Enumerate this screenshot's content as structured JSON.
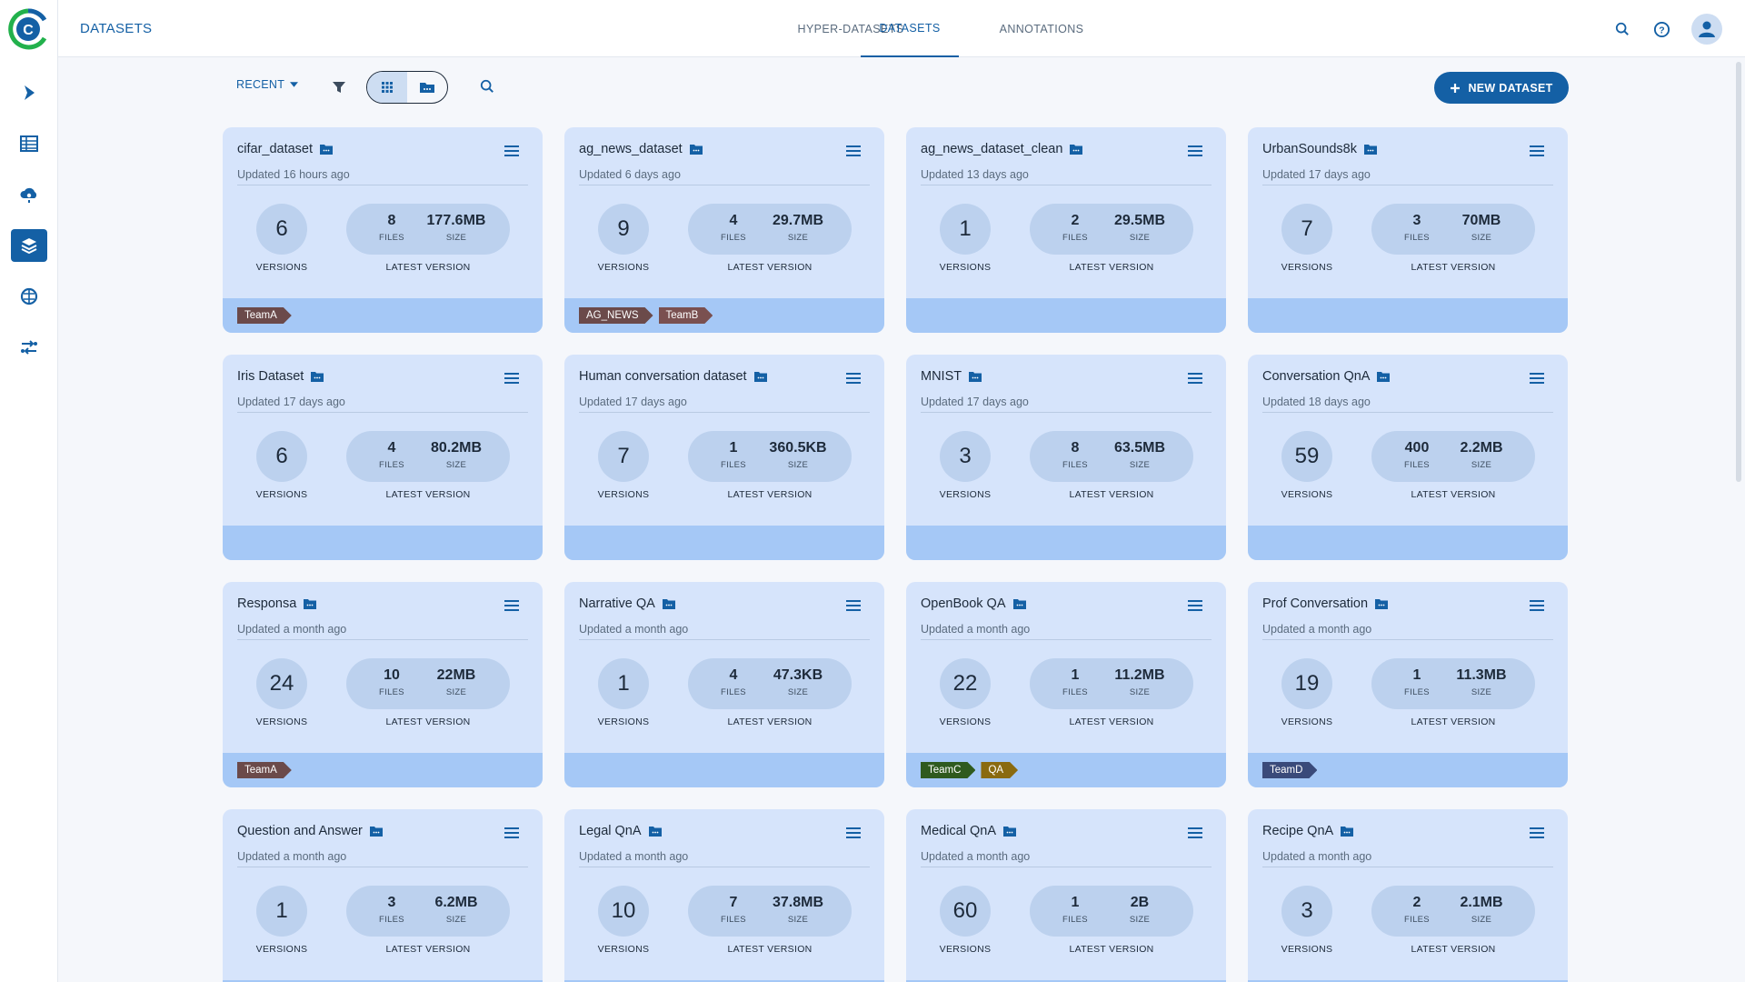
{
  "header": {
    "title": "DATASETS",
    "tabs": [
      {
        "label": "HYPER-DATASETS"
      },
      {
        "label": "DATASETS"
      },
      {
        "label": "ANNOTATIONS"
      }
    ]
  },
  "sidebar": {
    "items": [
      {
        "icon": "pipeline-play-icon"
      },
      {
        "icon": "table-icon"
      },
      {
        "icon": "cloud-gear-icon"
      },
      {
        "icon": "layers-icon"
      },
      {
        "icon": "brain-icon"
      },
      {
        "icon": "workflow-icon"
      }
    ]
  },
  "toolbar": {
    "sort_label": "RECENT",
    "new_dataset_label": "NEW DATASET"
  },
  "colors": {
    "accent": "#1460a5",
    "card": "#d6e4fb",
    "card_footer": "#a5c8f6"
  },
  "labels": {
    "versions": "VERSIONS",
    "latest_version": "LATEST VERSION",
    "files": "FILES",
    "size": "SIZE"
  },
  "cards": [
    {
      "name": "cifar_dataset",
      "updated": "Updated 16 hours ago",
      "versions": "6",
      "files": "8",
      "size": "177.6MB",
      "tags": [
        {
          "label": "TeamA",
          "color": "#6b4a4a"
        }
      ]
    },
    {
      "name": "ag_news_dataset",
      "updated": "Updated 6 days ago",
      "versions": "9",
      "files": "4",
      "size": "29.7MB",
      "tags": [
        {
          "label": "AG_NEWS",
          "color": "#6b4a4a"
        },
        {
          "label": "TeamB",
          "color": "#7a5050"
        }
      ]
    },
    {
      "name": "ag_news_dataset_clean",
      "updated": "Updated 13 days ago",
      "versions": "1",
      "files": "2",
      "size": "29.5MB",
      "tags": []
    },
    {
      "name": "UrbanSounds8k",
      "updated": "Updated 17 days ago",
      "versions": "7",
      "files": "3",
      "size": "70MB",
      "tags": []
    },
    {
      "name": "Iris Dataset",
      "updated": "Updated 17 days ago",
      "versions": "6",
      "files": "4",
      "size": "80.2MB",
      "tags": []
    },
    {
      "name": "Human conversation dataset",
      "updated": "Updated 17 days ago",
      "versions": "7",
      "files": "1",
      "size": "360.5KB",
      "tags": []
    },
    {
      "name": "MNIST",
      "updated": "Updated 17 days ago",
      "versions": "3",
      "files": "8",
      "size": "63.5MB",
      "tags": []
    },
    {
      "name": "Conversation QnA",
      "updated": "Updated 18 days ago",
      "versions": "59",
      "files": "400",
      "size": "2.2MB",
      "tags": []
    },
    {
      "name": "Responsa",
      "updated": "Updated a month ago",
      "versions": "24",
      "files": "10",
      "size": "22MB",
      "tags": [
        {
          "label": "TeamA",
          "color": "#6b4a4a"
        }
      ]
    },
    {
      "name": "Narrative QA",
      "updated": "Updated a month ago",
      "versions": "1",
      "files": "4",
      "size": "47.3KB",
      "tags": []
    },
    {
      "name": "OpenBook QA",
      "updated": "Updated a month ago",
      "versions": "22",
      "files": "1",
      "size": "11.2MB",
      "tags": [
        {
          "label": "TeamC",
          "color": "#2f5a1e"
        },
        {
          "label": "QA",
          "color": "#8a6a10"
        }
      ]
    },
    {
      "name": "Prof Conversation",
      "updated": "Updated a month ago",
      "versions": "19",
      "files": "1",
      "size": "11.3MB",
      "tags": [
        {
          "label": "TeamD",
          "color": "#3a4a7a"
        }
      ]
    },
    {
      "name": "Question and Answer",
      "updated": "Updated a month ago",
      "versions": "1",
      "files": "3",
      "size": "6.2MB",
      "tags": []
    },
    {
      "name": "Legal QnA",
      "updated": "Updated a month ago",
      "versions": "10",
      "files": "7",
      "size": "37.8MB",
      "tags": []
    },
    {
      "name": "Medical QnA",
      "updated": "Updated a month ago",
      "versions": "60",
      "files": "1",
      "size": "2B",
      "tags": []
    },
    {
      "name": "Recipe QnA",
      "updated": "Updated a month ago",
      "versions": "3",
      "files": "2",
      "size": "2.1MB",
      "tags": []
    }
  ]
}
